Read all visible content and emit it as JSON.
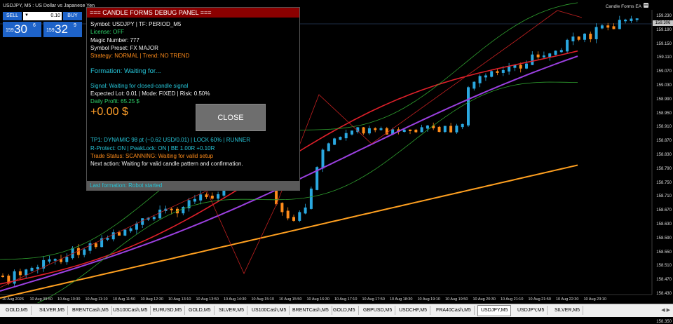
{
  "window": {
    "title": "USDJPY, M5 : US Dollar vs Japanese Yen"
  },
  "trade_widget": {
    "sell_label": "SELL",
    "buy_label": "BUY",
    "lot_value": "0.10",
    "bid": {
      "small": "159",
      "big": "30",
      "sup": "6"
    },
    "ask": {
      "small": "159",
      "big": "32",
      "sup": "9"
    }
  },
  "panel": {
    "title": "=== CANDLE FORMS DEBUG PANEL ===",
    "symbol_line": "Symbol: USDJPY | TF: PERIOD_M5",
    "license": "License: OFF",
    "magic": "Magic Number: 777",
    "preset": "Symbol Preset: FX MAJOR",
    "strategy": "Strategy: NORMAL | Trend: NO TREND",
    "formation": "Formation: Waiting for...",
    "signal": "Signal: Waiting for closed-candle signal",
    "lot_line": "Expected Lot: 0.01 | Mode: FIXED | Risk: 0.50%",
    "daily_profit": "Daily Profit: 65.25 $",
    "profit_big": "+0.00 $",
    "close_label": "CLOSE",
    "tp_line": "TP1: DYNAMIC 98 pt (~0.62 USD/0.01) | LOCK 60% | RUNNER",
    "protect_line": "R-Protect: ON | PeakLock: ON | BE 1.00R +0.10R",
    "status_line": "Trade Status: SCANNING: Waiting for valid setup",
    "next_line": "Next action: Waiting for valid candle pattern and confirmation.",
    "footer": "Last formation: Robot started"
  },
  "ea_label": "Candle Forms EA",
  "price_scale": [
    "159.230",
    "159.190",
    "159.150",
    "159.110",
    "159.070",
    "159.030",
    "158.990",
    "158.950",
    "158.910",
    "158.870",
    "158.830",
    "158.790",
    "158.750",
    "158.710",
    "158.670",
    "158.630",
    "158.590",
    "158.550",
    "158.510",
    "158.470",
    "158.430",
    "158.390",
    "158.350"
  ],
  "current_price": "159.306",
  "time_axis": [
    "10 Aug 2026",
    "10 Aug 09:50",
    "10 Aug 10:30",
    "10 Aug 11:10",
    "10 Aug 11:50",
    "10 Aug 12:30",
    "10 Aug 13:10",
    "10 Aug 13:50",
    "10 Aug 14:30",
    "10 Aug 15:10",
    "10 Aug 15:50",
    "10 Aug 16:30",
    "10 Aug 17:10",
    "10 Aug 17:50",
    "10 Aug 18:30",
    "10 Aug 19:10",
    "10 Aug 19:50",
    "10 Aug 20:30",
    "10 Aug 21:10",
    "10 Aug 21:50",
    "10 Aug 22:30",
    "10 Aug 23:10"
  ],
  "tabs": [
    "GOLD,M5",
    "SILVER,M5",
    "BRENTCash,M5",
    "US100Cash,M5",
    "EURUSD,M5",
    "GOLD,M5",
    "SILVER,M5",
    "US100Cash,M5",
    "BRENTCash,M5",
    "GOLD,M5",
    "GBPUSD,M5",
    "USDCHF,M5",
    "FRA40Cash,M5",
    "USDJPY,M5",
    "USDJPY,M5",
    "SILVER,M5"
  ],
  "active_tab_index": 13,
  "colors": {
    "bull": "#2aa8e0",
    "bear": "#ff8c1a",
    "ma_fast": "#e0202a",
    "ma_mid": "#9b40e0",
    "ma_slow": "#ffa020",
    "bands": "#2fa02f",
    "panel_title": "#8b0000"
  }
}
